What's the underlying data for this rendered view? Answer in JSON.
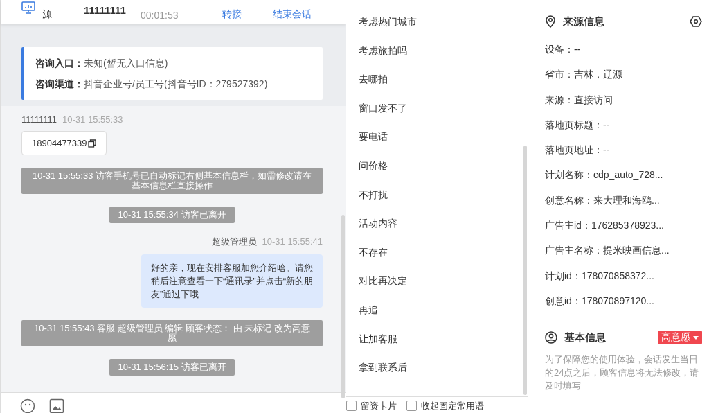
{
  "header": {
    "source_label": "源",
    "visitor_name": "11111111",
    "duration": "00:01:53",
    "actions": [
      {
        "label": "转接"
      },
      {
        "label": "结束会话"
      }
    ]
  },
  "consult_card": {
    "rows": [
      {
        "label": "咨询入口：",
        "value": "未知(暂无入口信息)"
      },
      {
        "label": "咨询渠道：",
        "value": "抖音企业号/员工号(抖音号ID：279527392)"
      }
    ]
  },
  "messages": [
    {
      "kind": "incoming",
      "sender": "11111111",
      "time": "10-31 15:55:33",
      "text": "18904477339"
    },
    {
      "kind": "system",
      "text": "10-31 15:55:33 访客手机号已自动标记右侧基本信息栏，如需修改请在基本信息栏直接操作"
    },
    {
      "kind": "system",
      "text": "10-31 15:55:34 访客已离开"
    },
    {
      "kind": "outgoing",
      "sender": "超级管理员",
      "time": "10-31 15:55:41",
      "text": "好的亲，现在安排客服加您介绍哈。请您稍后注意查看一下“通讯录”并点击“新的朋友”通过下哦"
    },
    {
      "kind": "system",
      "text": "10-31 15:55:43 客服 超级管理员 编辑 顾客状态： 由 未标记 改为高意愿"
    },
    {
      "kind": "system",
      "text": "10-31 15:56:15 访客已离开"
    }
  ],
  "composer": {
    "options": [
      {
        "label": "留资卡片",
        "checked": false
      },
      {
        "label": "收起固定常用语",
        "checked": false
      }
    ]
  },
  "quick_replies": [
    "考虑热门城市",
    "考虑旅拍吗",
    "去哪拍",
    "窗口发不了",
    "要电话",
    "问价格",
    "不打扰",
    "活动内容",
    "不存在",
    "对比再决定",
    "再追",
    "让加客服",
    "拿到联系后"
  ],
  "source_info": {
    "title": "来源信息",
    "fields": [
      "设备：--",
      "省市：吉林，辽源",
      "来源：直接访问",
      "落地页标题：--",
      "落地页地址：--",
      "计划名称：cdp_auto_728...",
      "创意名称：来大理和海鸥...",
      "广告主id：176285378923...",
      "广告主名称：提米映画信息...",
      "计划id：178070858372...",
      "创意id：178070897120..."
    ]
  },
  "basic_info": {
    "title": "基本信息",
    "status": "高意愿",
    "notice": "为了保障您的使用体验，会话发生当日的24点之后，顾客信息将无法修改，请及时填写"
  }
}
